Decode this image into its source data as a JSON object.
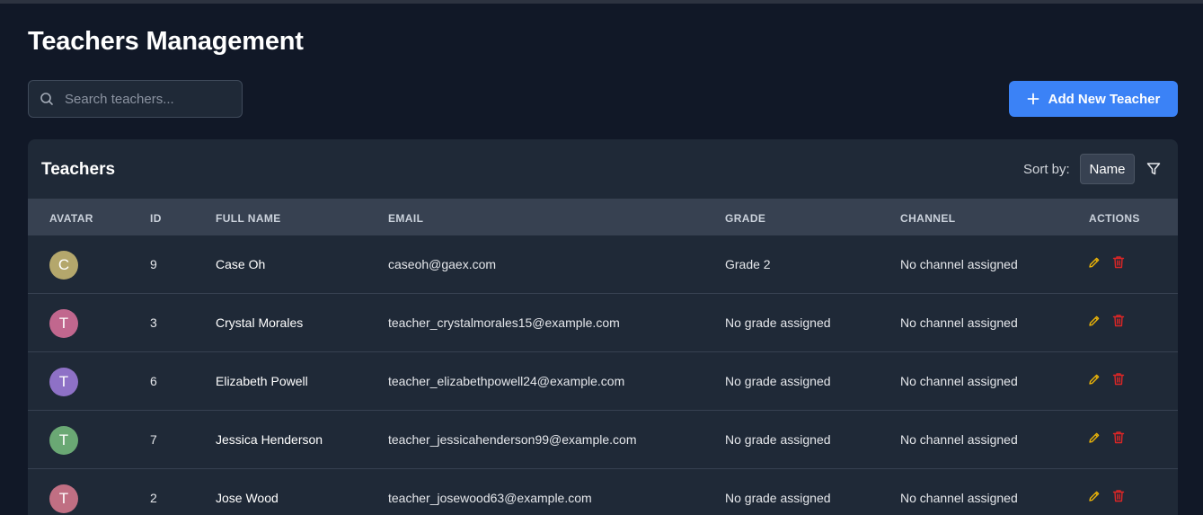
{
  "page": {
    "title": "Teachers Management"
  },
  "search": {
    "placeholder": "Search teachers..."
  },
  "actions": {
    "add_label": "Add New Teacher"
  },
  "card": {
    "title": "Teachers",
    "sort_label": "Sort by:",
    "sort_value": "Name"
  },
  "table": {
    "headers": [
      "AVATAR",
      "ID",
      "FULL NAME",
      "EMAIL",
      "GRADE",
      "CHANNEL",
      "ACTIONS"
    ],
    "rows": [
      {
        "initial": "C",
        "avatar_color": "#b4a76c",
        "id": "9",
        "name": "Case Oh",
        "email": "caseoh@gaex.com",
        "grade": "Grade 2",
        "channel": "No channel assigned"
      },
      {
        "initial": "T",
        "avatar_color": "#c1678e",
        "id": "3",
        "name": "Crystal Morales",
        "email": "teacher_crystalmorales15@example.com",
        "grade": "No grade assigned",
        "channel": "No channel assigned"
      },
      {
        "initial": "T",
        "avatar_color": "#8e71c6",
        "id": "6",
        "name": "Elizabeth Powell",
        "email": "teacher_elizabethpowell24@example.com",
        "grade": "No grade assigned",
        "channel": "No channel assigned"
      },
      {
        "initial": "T",
        "avatar_color": "#6aa874",
        "id": "7",
        "name": "Jessica Henderson",
        "email": "teacher_jessicahenderson99@example.com",
        "grade": "No grade assigned",
        "channel": "No channel assigned"
      },
      {
        "initial": "T",
        "avatar_color": "#c06f83",
        "id": "2",
        "name": "Jose Wood",
        "email": "teacher_josewood63@example.com",
        "grade": "No grade assigned",
        "channel": "No channel assigned"
      }
    ]
  },
  "colors": {
    "accent": "#3b82f6",
    "edit_icon": "#eab308",
    "delete_icon": "#dc2626"
  },
  "icons": {
    "search": "search-icon",
    "add": "plus-icon",
    "filter": "filter-icon",
    "edit": "pencil-icon",
    "delete": "trash-icon"
  }
}
